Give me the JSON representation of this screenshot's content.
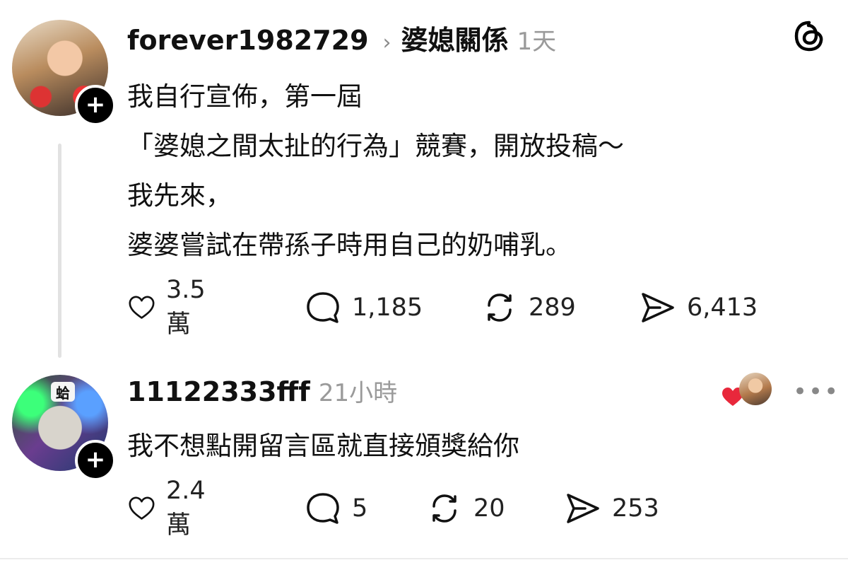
{
  "post": {
    "username": "forever1982729",
    "topic": "婆媳關係",
    "time": "1天",
    "lines": [
      "我自行宣佈，第一屆",
      "「婆媳之間太扯的行為」競賽，開放投稿～",
      "我先來，",
      "婆婆嘗試在帶孫子時用自己的奶哺乳。"
    ],
    "stats": {
      "likes": "3.5萬",
      "comments": "1,185",
      "reposts": "289",
      "shares": "6,413"
    }
  },
  "reply": {
    "username": "11122333fff",
    "time": "21小時",
    "avatar_badge": "蛤",
    "text": "我不想點開留言區就直接頒獎給你",
    "stats": {
      "likes": "2.4萬",
      "comments": "5",
      "reposts": "20",
      "shares": "253"
    },
    "more": "•••"
  },
  "icons": {
    "plus": "+",
    "chevron": "›"
  },
  "colors": {
    "heart": "#e8283b",
    "muted": "#9a9a9a",
    "text": "#111111"
  }
}
